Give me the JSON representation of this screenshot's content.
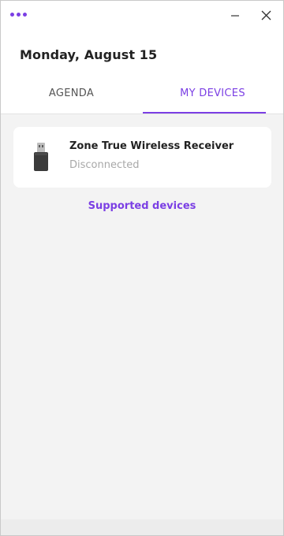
{
  "window": {
    "menu_icon": "more-dots-icon",
    "minimize_icon": "minimize-icon",
    "close_icon": "close-icon"
  },
  "header": {
    "date": "Monday, August 15"
  },
  "tabs": [
    {
      "label": "AGENDA",
      "active": false
    },
    {
      "label": "MY DEVICES",
      "active": true
    }
  ],
  "devices": [
    {
      "name": "Zone True Wireless Receiver",
      "status": "Disconnected",
      "icon": "usb-receiver-icon"
    }
  ],
  "links": {
    "supported_devices": "Supported devices"
  },
  "colors": {
    "accent": "#7b3fe4",
    "status_text": "#a8a8a8",
    "background": "#f3f3f3",
    "card": "#ffffff"
  }
}
